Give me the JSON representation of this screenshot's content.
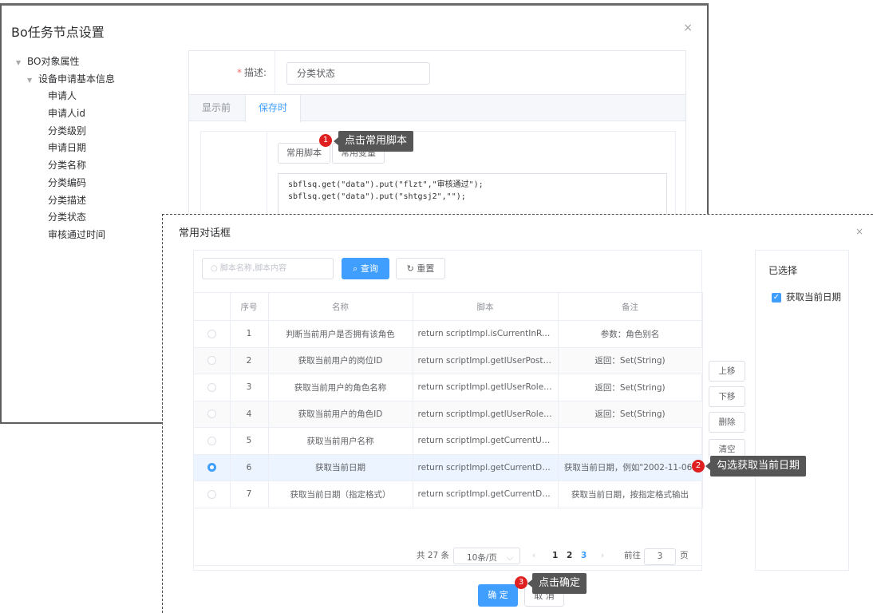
{
  "bo_dialog": {
    "title": "Bo任务节点设置",
    "close": "×",
    "tree": {
      "root": "BO对象属性",
      "group": "设备申请基本信息",
      "leaves": [
        "申请人",
        "申请人id",
        "分类级别",
        "申请日期",
        "分类名称",
        "分类编码",
        "分类描述",
        "分类状态",
        "审核通过时间"
      ]
    },
    "form": {
      "desc_label": "描述:",
      "desc_value": "分类状态",
      "tabs": [
        "显示前",
        "保存时"
      ],
      "active_tab": "保存时",
      "btn_common_script": "常用脚本",
      "btn_variable": "常用变量",
      "code_lines": [
        "sbflsq.get(\"data\").put(\"flzt\",\"审核通过\");",
        "sbflsq.get(\"data\").put(\"shtgsj2\",\"\");"
      ]
    }
  },
  "common_dialog": {
    "title": "常用对话框",
    "close": "×",
    "search_placeholder": "脚本名称,脚本内容",
    "search_button": "查询",
    "reset_button": "重置",
    "columns": [
      "",
      "序号",
      "名称",
      "脚本",
      "备注"
    ],
    "rows": [
      {
        "no": "1",
        "name": "判断当前用户是否拥有该角色",
        "script": "return scriptImpl.isCurrentInRol...",
        "remark": "参数：角色别名"
      },
      {
        "no": "2",
        "name": "获取当前用户的岗位ID",
        "script": "return scriptImpl.getlUserPostID();",
        "remark": "返回：Set(String)"
      },
      {
        "no": "3",
        "name": "获取当前用户的角色名称",
        "script": "return scriptImpl.getlUserRoleN...",
        "remark": "返回：Set(String)"
      },
      {
        "no": "4",
        "name": "获取当前用户的角色ID",
        "script": "return scriptImpl.getlUserRoleID...",
        "remark": "返回：Set(String)"
      },
      {
        "no": "5",
        "name": "获取当前用户名称",
        "script": "return scriptImpl.getCurrentUse...",
        "remark": ""
      },
      {
        "no": "6",
        "name": "获取当前日期",
        "script": "return scriptImpl.getCurrentDat...",
        "remark": "获取当前日期，例如\"2002-11-06\""
      },
      {
        "no": "7",
        "name": "获取当前日期（指定格式）",
        "script": "return scriptImpl.getCurrentDat...",
        "remark": "获取当前日期，按指定格式输出"
      }
    ],
    "selected_row": "6",
    "pager": {
      "total": "共 27 条",
      "page_size": "10条/页",
      "prev": "‹",
      "pages": [
        "1",
        "2",
        "3"
      ],
      "current": "3",
      "next": "›",
      "goto_label": "前往",
      "goto_value": "3",
      "page_suffix": "页"
    },
    "side_buttons": [
      "上移",
      "下移",
      "删除",
      "清空"
    ],
    "selected_title": "已选择",
    "selected_items": [
      "获取当前日期"
    ],
    "confirm": "确 定",
    "cancel": "取 消"
  },
  "annotations": [
    {
      "num": "1",
      "text": "点击常用脚本"
    },
    {
      "num": "2",
      "text": "勾选获取当前日期"
    },
    {
      "num": "3",
      "text": "点击确定"
    }
  ],
  "colors": {
    "primary": "#409eff",
    "badge": "#e02020",
    "tip": "#565656"
  }
}
